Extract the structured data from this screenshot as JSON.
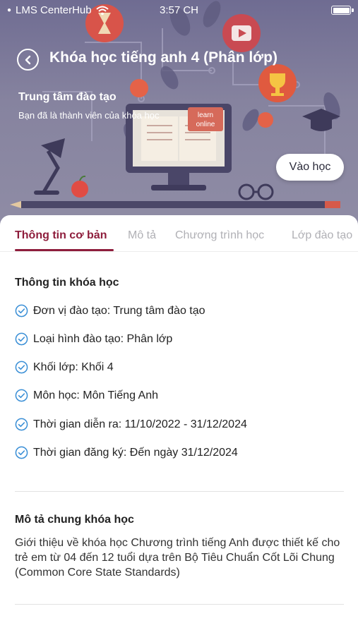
{
  "status_bar": {
    "carrier": "LMS CenterHub",
    "time": "3:57 CH"
  },
  "header": {
    "title": "Khóa học tiếng anh 4 (Phân lớp)",
    "center_name": "Trung tâm đào tạo",
    "member_note": "Bạn đã là thành viên của khóa học",
    "banner_sign": [
      "learn",
      "online"
    ],
    "enter_button": "Vào học"
  },
  "tabs": [
    {
      "label": "Thông tin cơ bản",
      "active": true
    },
    {
      "label": "Mô tả",
      "active": false
    },
    {
      "label": "Chương trình học",
      "active": false
    },
    {
      "label": "Lớp đào tạo",
      "active": false
    }
  ],
  "course_info": {
    "heading": "Thông tin khóa học",
    "items": [
      "Đơn vị đào tạo: Trung tâm đào tạo",
      "Loại hình đào tạo: Phân lớp",
      "Khối lớp: Khối 4",
      "Môn học: Môn Tiếng Anh",
      "Thời gian diễn ra: 11/10/2022 - 31/12/2024",
      "Thời gian đăng ký: Đến ngày 31/12/2024"
    ]
  },
  "description": {
    "heading": "Mô tả chung khóa học",
    "text": "  Giới thiệu về khóa học Chương trình tiếng Anh được thiết kế cho trẻ em từ 04 đến 12 tuổi dựa trên Bộ Tiêu Chuẩn Cốt Lõi Chung (Common Core State Standards)"
  },
  "colors": {
    "accent": "#8e1d3c",
    "check": "#3a8fd6",
    "hero_bg": "#7f7c9b"
  },
  "icons": {
    "back": "chevron-left-icon",
    "check": "check-circle-icon",
    "wifi": "wifi-icon",
    "battery": "battery-icon"
  }
}
